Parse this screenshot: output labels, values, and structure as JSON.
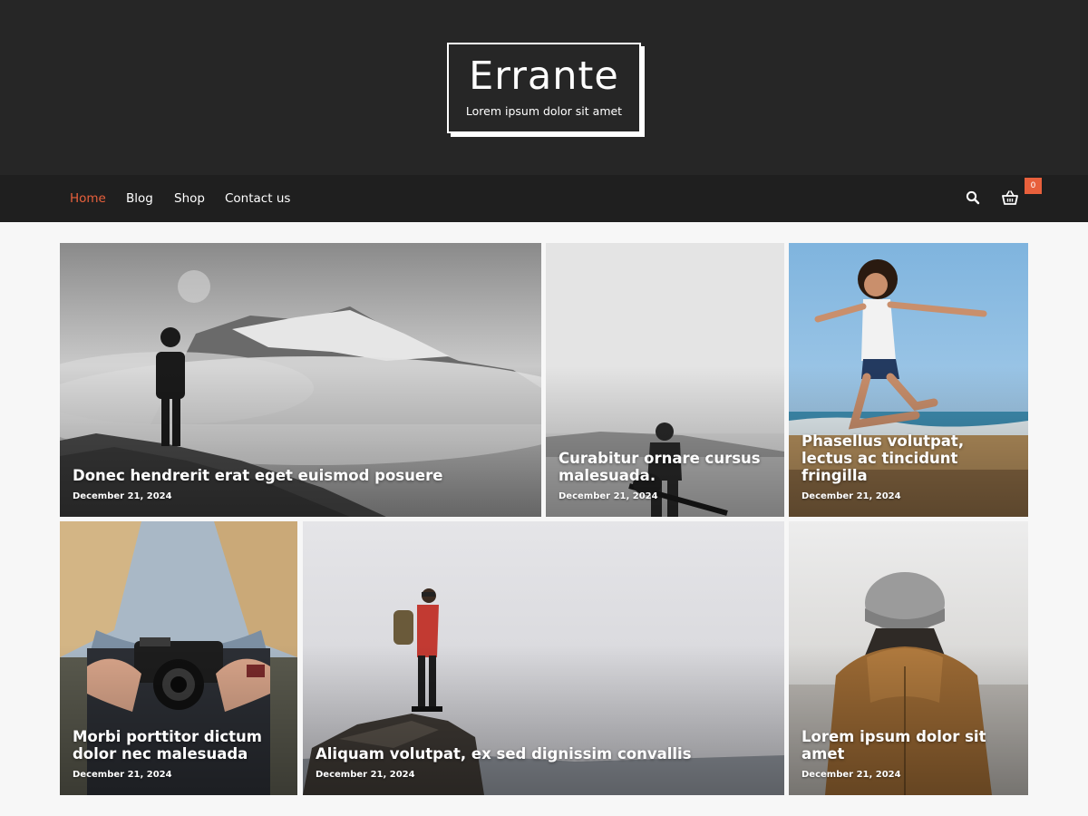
{
  "site": {
    "title": "Errante",
    "tagline": "Lorem ipsum dolor sit amet"
  },
  "nav": {
    "items": [
      {
        "label": "Home",
        "active": true
      },
      {
        "label": "Blog",
        "active": false
      },
      {
        "label": "Shop",
        "active": false
      },
      {
        "label": "Contact us",
        "active": false
      }
    ],
    "search_icon": "search-icon",
    "cart_icon": "basket-icon",
    "cart_count": "0"
  },
  "colors": {
    "header_bg": "#262626",
    "nav_bg": "#1f1f1f",
    "accent": "#e8603c",
    "page_bg": "#f7f7f7"
  },
  "posts": [
    {
      "title": "Donec hendrerit erat eget euismod posuere",
      "date": "December 21, 2024"
    },
    {
      "title": "Curabitur ornare cursus malesuada.",
      "date": "December 21, 2024"
    },
    {
      "title": "Phasellus volutpat, lectus ac tincidunt fringilla",
      "date": "December 21, 2024"
    },
    {
      "title": "Morbi porttitor dictum dolor nec malesuada",
      "date": "December 21, 2024"
    },
    {
      "title": "Aliquam volutpat, ex sed dignissim convallis",
      "date": "December 21, 2024"
    },
    {
      "title": "Lorem ipsum dolor sit amet",
      "date": "December 21, 2024"
    }
  ]
}
